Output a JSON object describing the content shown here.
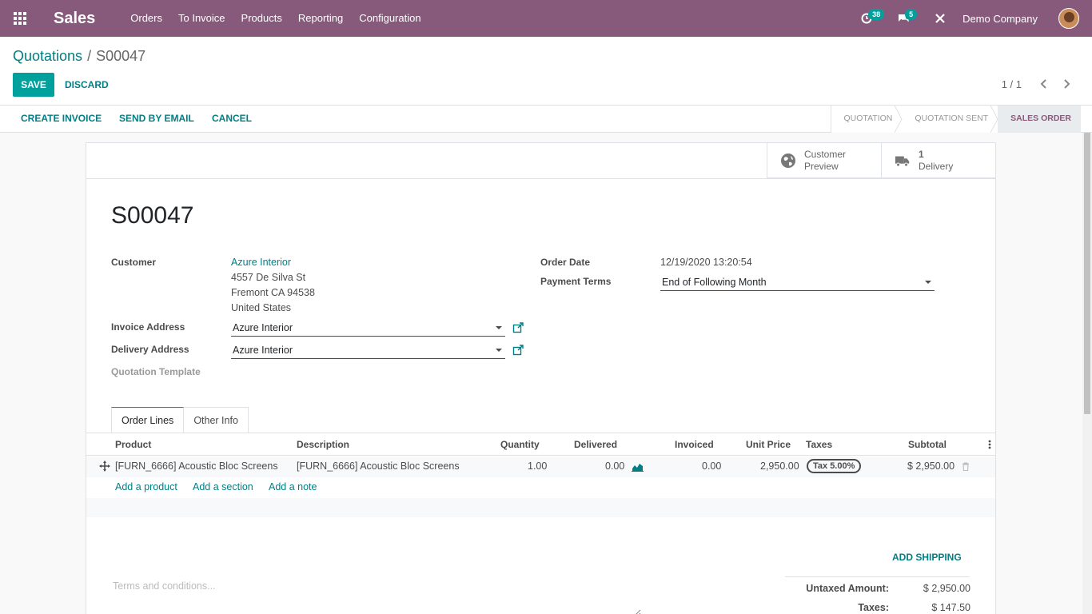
{
  "app": {
    "name": "Sales"
  },
  "nav": {
    "menu": [
      "Orders",
      "To Invoice",
      "Products",
      "Reporting",
      "Configuration"
    ],
    "activity_count": "38",
    "message_count": "5",
    "company": "Demo Company"
  },
  "breadcrumb": {
    "parent": "Quotations",
    "separator": "/",
    "current": "S00047"
  },
  "toolbar": {
    "save_label": "SAVE",
    "discard_label": "DISCARD"
  },
  "pager": {
    "text": "1 / 1"
  },
  "actions": {
    "create_invoice": "CREATE INVOICE",
    "send_email": "SEND BY EMAIL",
    "cancel": "CANCEL"
  },
  "stages": [
    {
      "label": "QUOTATION",
      "active": false
    },
    {
      "label": "QUOTATION SENT",
      "active": false
    },
    {
      "label": "SALES ORDER",
      "active": true
    }
  ],
  "smart_buttons": {
    "preview": {
      "line1": "Customer",
      "line2": "Preview"
    },
    "delivery": {
      "count": "1",
      "label": "Delivery"
    }
  },
  "record": {
    "title": "S00047",
    "customer_label": "Customer",
    "customer_name": "Azure Interior",
    "customer_address": [
      "4557 De Silva St",
      "Fremont CA 94538",
      "United States"
    ],
    "invoice_address_label": "Invoice Address",
    "invoice_address": "Azure Interior",
    "delivery_address_label": "Delivery Address",
    "delivery_address": "Azure Interior",
    "quotation_template_label": "Quotation Template",
    "order_date_label": "Order Date",
    "order_date": "12/19/2020 13:20:54",
    "payment_terms_label": "Payment Terms",
    "payment_terms": "End of Following Month"
  },
  "tabs": [
    "Order Lines",
    "Other Info"
  ],
  "order_lines": {
    "columns": [
      "Product",
      "Description",
      "Quantity",
      "Delivered",
      "Invoiced",
      "Unit Price",
      "Taxes",
      "Subtotal"
    ],
    "rows": [
      {
        "product": "[FURN_6666] Acoustic Bloc Screens",
        "description": "[FURN_6666] Acoustic Bloc Screens",
        "quantity": "1.00",
        "delivered": "0.00",
        "invoiced": "0.00",
        "unit_price": "2,950.00",
        "taxes": "Tax 5.00%",
        "subtotal": "$ 2,950.00"
      }
    ],
    "add_product": "Add a product",
    "add_section": "Add a section",
    "add_note": "Add a note"
  },
  "footer": {
    "add_shipping": "ADD SHIPPING",
    "terms_placeholder": "Terms and conditions...",
    "untaxed_label": "Untaxed Amount:",
    "untaxed_value": "$ 2,950.00",
    "taxes_label": "Taxes:",
    "taxes_value": "$ 147.50"
  },
  "colors": {
    "brand": "#875a7b",
    "accent": "#00a09d",
    "link": "#017e84"
  }
}
